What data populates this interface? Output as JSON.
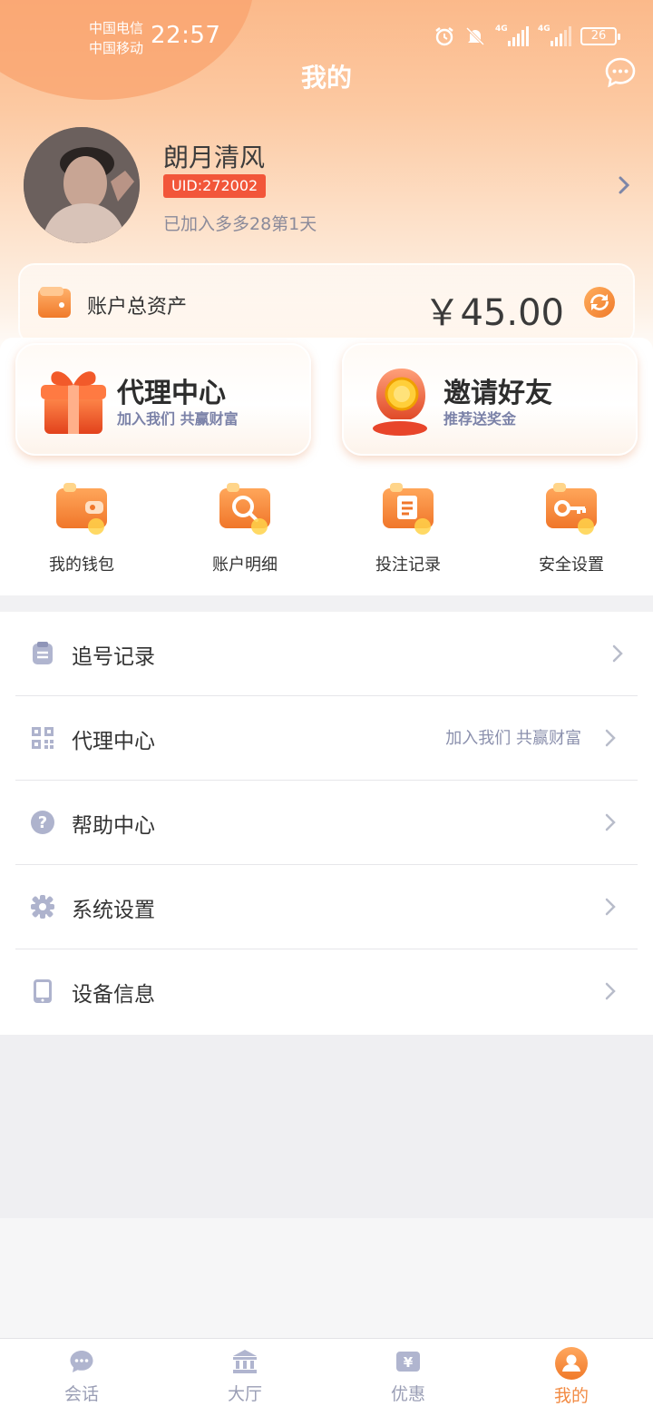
{
  "status_bar": {
    "carrier_1": "中国电信",
    "carrier_2": "中国移动",
    "time": "22:57",
    "signal_1_label": "4G",
    "signal_2_label": "4G",
    "battery": "26"
  },
  "header": {
    "title": "我的",
    "chat_icon": "chat-bubble-icon"
  },
  "profile": {
    "username": "朗月清风",
    "uid": "UID:272002",
    "join_text": "已加入多多28第1天"
  },
  "assets": {
    "label": "账户总资产",
    "amount": "￥45.00"
  },
  "feature_cards": [
    {
      "title": "代理中心",
      "subtitle": "加入我们 共赢财富",
      "icon": "gift-box-icon"
    },
    {
      "title": "邀请好友",
      "subtitle": "推荐送奖金",
      "icon": "coin-hand-icon"
    }
  ],
  "quick_actions": [
    {
      "label": "我的钱包",
      "icon": "wallet-icon"
    },
    {
      "label": "账户明细",
      "icon": "search-icon"
    },
    {
      "label": "投注记录",
      "icon": "notepad-icon"
    },
    {
      "label": "安全设置",
      "icon": "key-icon"
    }
  ],
  "menu": [
    {
      "label": "追号记录",
      "sub": "",
      "icon": "clipboard-icon"
    },
    {
      "label": "代理中心",
      "sub": "加入我们 共赢财富",
      "icon": "qrcode-icon"
    },
    {
      "label": "帮助中心",
      "sub": "",
      "icon": "question-icon"
    },
    {
      "label": "系统设置",
      "sub": "",
      "icon": "gear-icon"
    },
    {
      "label": "设备信息",
      "sub": "",
      "icon": "tablet-icon"
    }
  ],
  "tabs": [
    {
      "label": "会话",
      "icon": "chat-icon",
      "active": false
    },
    {
      "label": "大厅",
      "icon": "bank-icon",
      "active": false
    },
    {
      "label": "优惠",
      "icon": "coupon-icon",
      "active": false
    },
    {
      "label": "我的",
      "icon": "user-icon",
      "active": true
    }
  ],
  "colors": {
    "accent": "#f28b44",
    "uid_badge": "#f2563a",
    "muted_text": "#8b90ad"
  }
}
